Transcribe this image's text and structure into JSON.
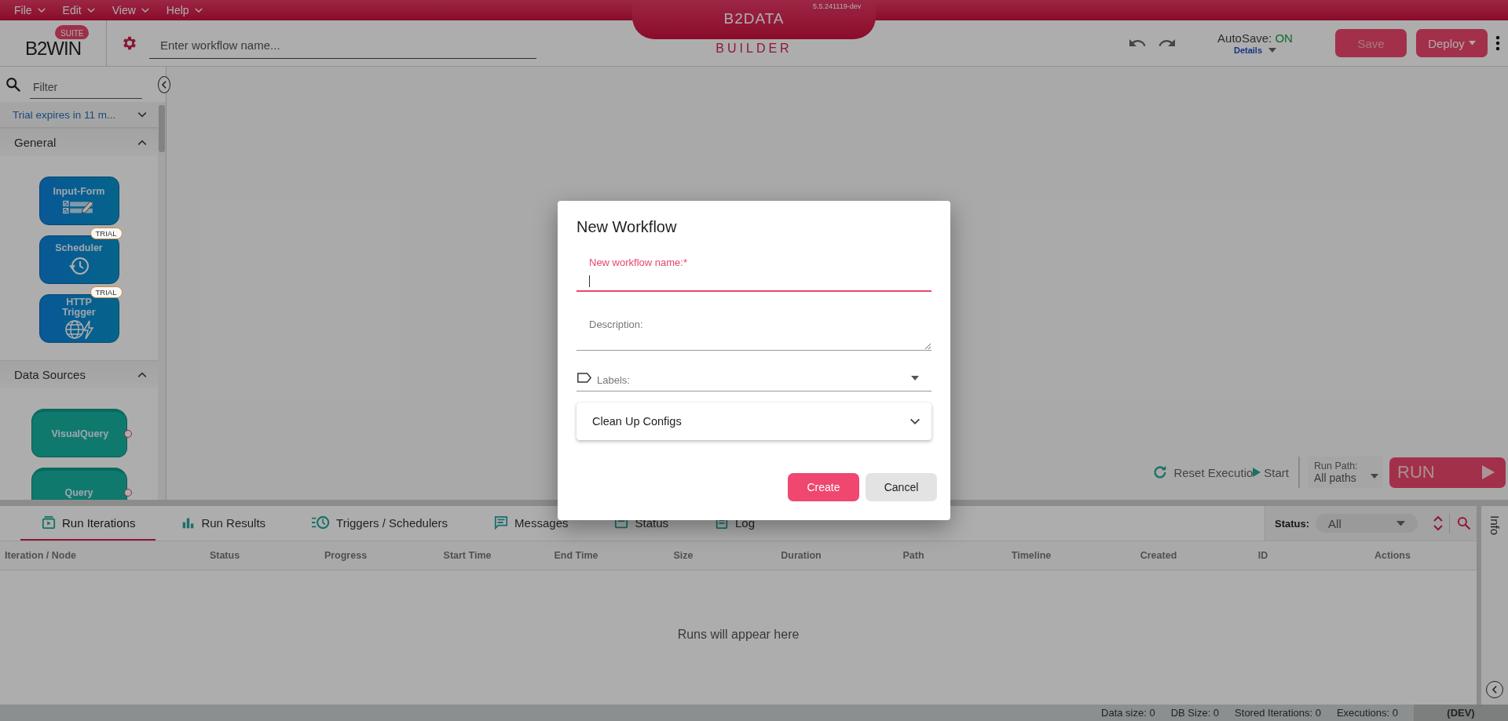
{
  "menu": [
    {
      "label": "File"
    },
    {
      "label": "Edit"
    },
    {
      "label": "View"
    },
    {
      "label": "Help"
    }
  ],
  "product": {
    "name": "B2DATA",
    "subtitle": "BUILDER",
    "version": "5.5.241119-dev"
  },
  "logo": {
    "text": "B2WIN",
    "badge": "SUITE"
  },
  "workflow_name": {
    "placeholder": "Enter workflow name..."
  },
  "autosave": {
    "label": "AutoSave:",
    "value": "ON",
    "on": true,
    "details": "Details"
  },
  "actions": [
    {
      "label": "Save",
      "kind": "plain",
      "disabled": true
    },
    {
      "label": "Deploy",
      "kind": "dropdown",
      "disabled": false
    }
  ],
  "sidebar": {
    "filter": {
      "placeholder": "Filter"
    },
    "trial_notice": "Trial expires in 11 m...",
    "sections": [
      {
        "title": "General",
        "expanded": true,
        "nodes": [
          {
            "label": "Input-Form",
            "kind": "input-form"
          },
          {
            "label": "Scheduler",
            "kind": "scheduler",
            "badge": "TRIAL"
          },
          {
            "label": "HTTP Trigger",
            "kind": "http-trigger",
            "badge": "TRIAL"
          }
        ]
      },
      {
        "title": "Data Sources",
        "expanded": true,
        "nodes": [
          {
            "label": "VisualQuery",
            "kind": "visual-query"
          },
          {
            "label": "Query",
            "kind": "query"
          }
        ]
      }
    ]
  },
  "run_controls": {
    "reset": "Reset Executio",
    "start": "Start",
    "run_path": {
      "label": "Run Path:",
      "value": "All paths"
    },
    "run": "RUN"
  },
  "bottom_panel": {
    "tabs": [
      {
        "label": "Run Iterations",
        "kind": "iterations",
        "selected": true
      },
      {
        "label": "Run Results",
        "kind": "results",
        "selected": false
      },
      {
        "label": "Triggers / Schedulers",
        "kind": "triggers",
        "selected": false
      },
      {
        "label": "Messages",
        "kind": "messages",
        "selected": false
      },
      {
        "label": "Status",
        "kind": "status",
        "selected": false
      },
      {
        "label": "Log",
        "kind": "log",
        "selected": false
      }
    ],
    "status_filter": {
      "label": "Status:",
      "value": "All"
    },
    "columns": [
      "Iteration / Node",
      "Status",
      "Progress",
      "Start Time",
      "End Time",
      "Size",
      "Duration",
      "Path",
      "Timeline",
      "Created",
      "ID",
      "Actions"
    ],
    "empty_message": "Runs will appear here",
    "side_tab": "Info"
  },
  "status_bar": {
    "items": [
      "Data size: 0",
      "DB Size: 0",
      "Stored Iterations: 0",
      "Executions: 0"
    ],
    "environment": "(DEV)"
  },
  "dialog": {
    "title": "New Workflow",
    "fields": [
      {
        "kind": "text",
        "label": "New workflow name:",
        "required_mark": "*",
        "focused": true
      },
      {
        "kind": "textarea",
        "label": "Description:",
        "focused": false
      },
      {
        "kind": "select",
        "label": "Labels:",
        "focused": false
      }
    ],
    "sections": [
      {
        "title": "Clean Up Configs",
        "expanded": false
      }
    ],
    "buttons": [
      {
        "label": "Create",
        "kind": "primary"
      },
      {
        "label": "Cancel",
        "kind": "secondary"
      }
    ]
  }
}
